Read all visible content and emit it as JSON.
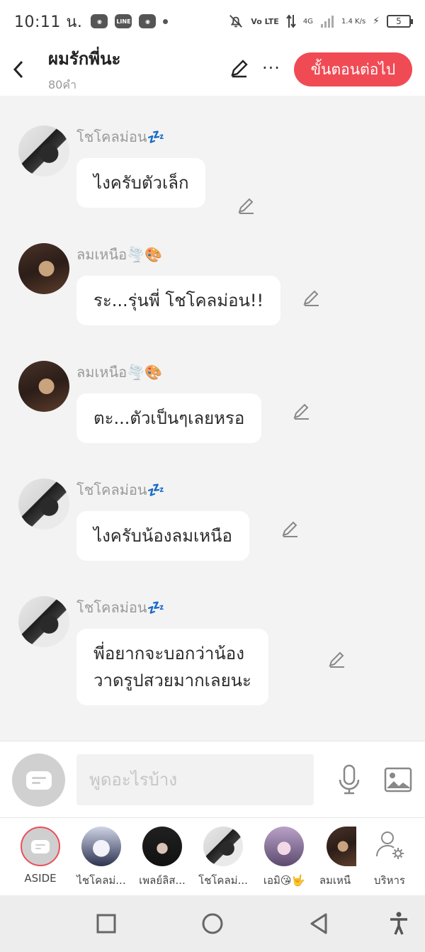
{
  "status_bar": {
    "time": "10:11 น.",
    "network": "Vo LTE",
    "speed": "1.4 K/s",
    "signal": "4G",
    "battery": "5",
    "app_icons": [
      "discord-icon",
      "line-icon",
      "discord-icon"
    ]
  },
  "header": {
    "title": "ผมรักพี่นะ",
    "word_count": "80คำ",
    "next_label": "ขั้นตอนต่อไป",
    "more_label": "···"
  },
  "messages": [
    {
      "sender": "โชโคลม่อน💤",
      "text": "ไงครับตัวเล็ก",
      "avatar": "av-a"
    },
    {
      "sender": "ลมเหนือ🌪️🎨",
      "text": "ระ...รุ่นพี่ โชโคลม่อน!!",
      "avatar": "av-b"
    },
    {
      "sender": "ลมเหนือ🌪️🎨",
      "text": "ตะ...ตัวเป็นๆเลยหรอ",
      "avatar": "av-b"
    },
    {
      "sender": "โชโคลม่อน💤",
      "text": "ไงครับน้องลมเหนือ",
      "avatar": "av-a"
    },
    {
      "sender": "โชโคลม่อน💤",
      "text": "พี่อยากจะบอกว่าน้อง\nวาดรูปสวยมากเลยนะ",
      "avatar": "av-a"
    }
  ],
  "input": {
    "placeholder": "พูดอะไรบ้าง",
    "value": ""
  },
  "characters": [
    {
      "name": "ASIDE",
      "avatar": "aside"
    },
    {
      "name": "ไชโคลม่...",
      "avatar": "av-c"
    },
    {
      "name": "เพลย์ลิส...",
      "avatar": "av-d"
    },
    {
      "name": "โชโคลม่...",
      "avatar": "av-a"
    },
    {
      "name": "เอมิ😘🤟",
      "avatar": "av-e"
    },
    {
      "name": "ลมเหนื",
      "avatar": "av-b"
    }
  ],
  "manage_label": "บริหาร",
  "colors": {
    "accent": "#f04b55",
    "background": "#f3f3f3",
    "bubble": "#ffffff",
    "sender": "#9a9a9a"
  }
}
